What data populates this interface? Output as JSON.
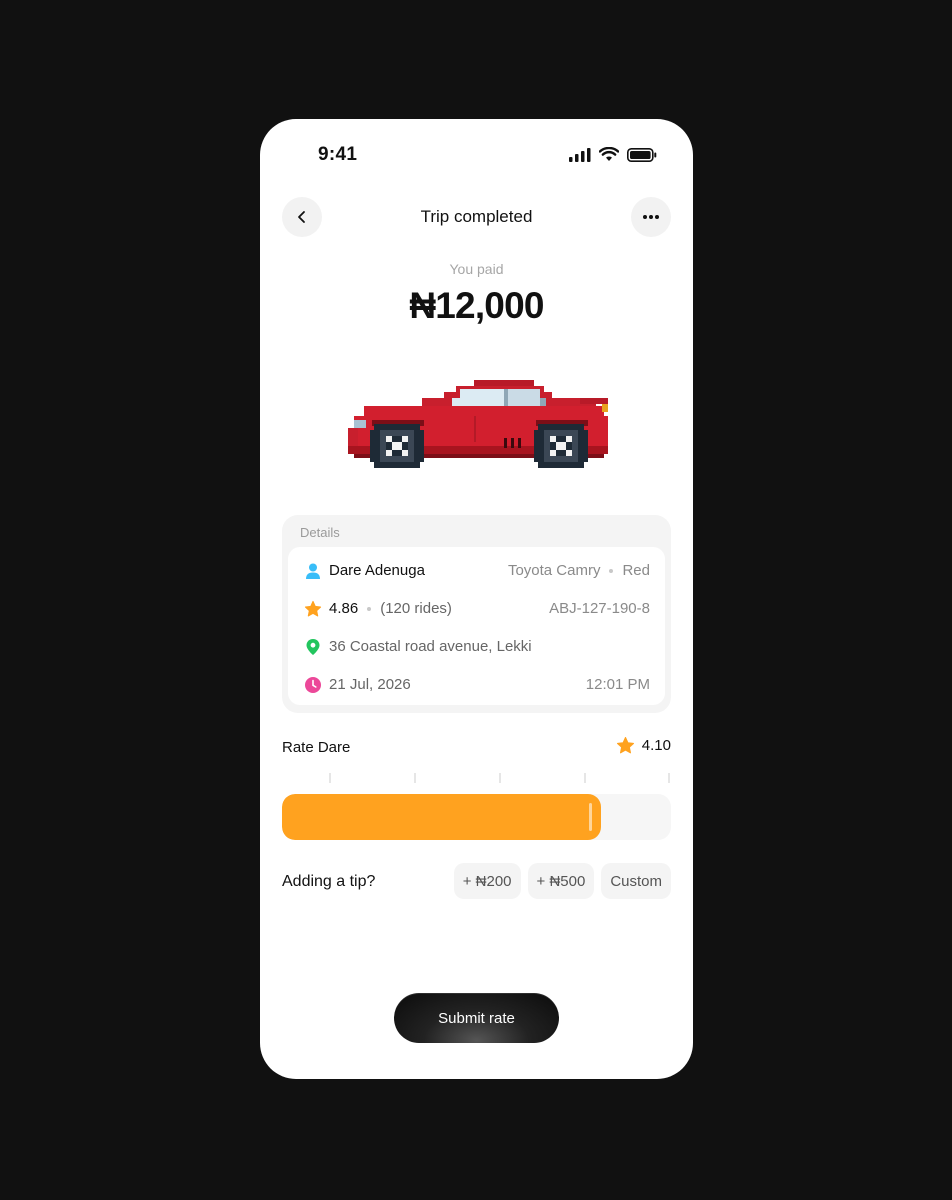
{
  "status": {
    "time": "9:41"
  },
  "header": {
    "title": "Trip completed",
    "back_icon": "chevron-left-icon",
    "more_icon": "ellipsis-icon"
  },
  "payment": {
    "label": "You paid",
    "amount": "₦12,000"
  },
  "details": {
    "title": "Details",
    "driver_name": "Dare Adenuga",
    "car_model": "Toyota Camry",
    "car_color": "Red",
    "rating": "4.86",
    "rides": "(120 rides)",
    "plate": "ABJ-127-190-8",
    "address": "36 Coastal road avenue, Lekki",
    "date": "21 Jul, 2026",
    "time": "12:01 PM"
  },
  "rate": {
    "label": "Rate Dare",
    "value": "4.10",
    "fraction": 0.82,
    "max": 5
  },
  "tip": {
    "label": "Adding a tip?",
    "options": [
      "+ ₦200",
      "+ ₦500",
      "Custom"
    ]
  },
  "submit_label": "Submit rate",
  "colors": {
    "accent": "#FFA21F",
    "star": "#FFA21F",
    "location": "#22C55E",
    "clock": "#EC4899",
    "person": "#38BDF8",
    "car_body": "#D21F2E"
  }
}
